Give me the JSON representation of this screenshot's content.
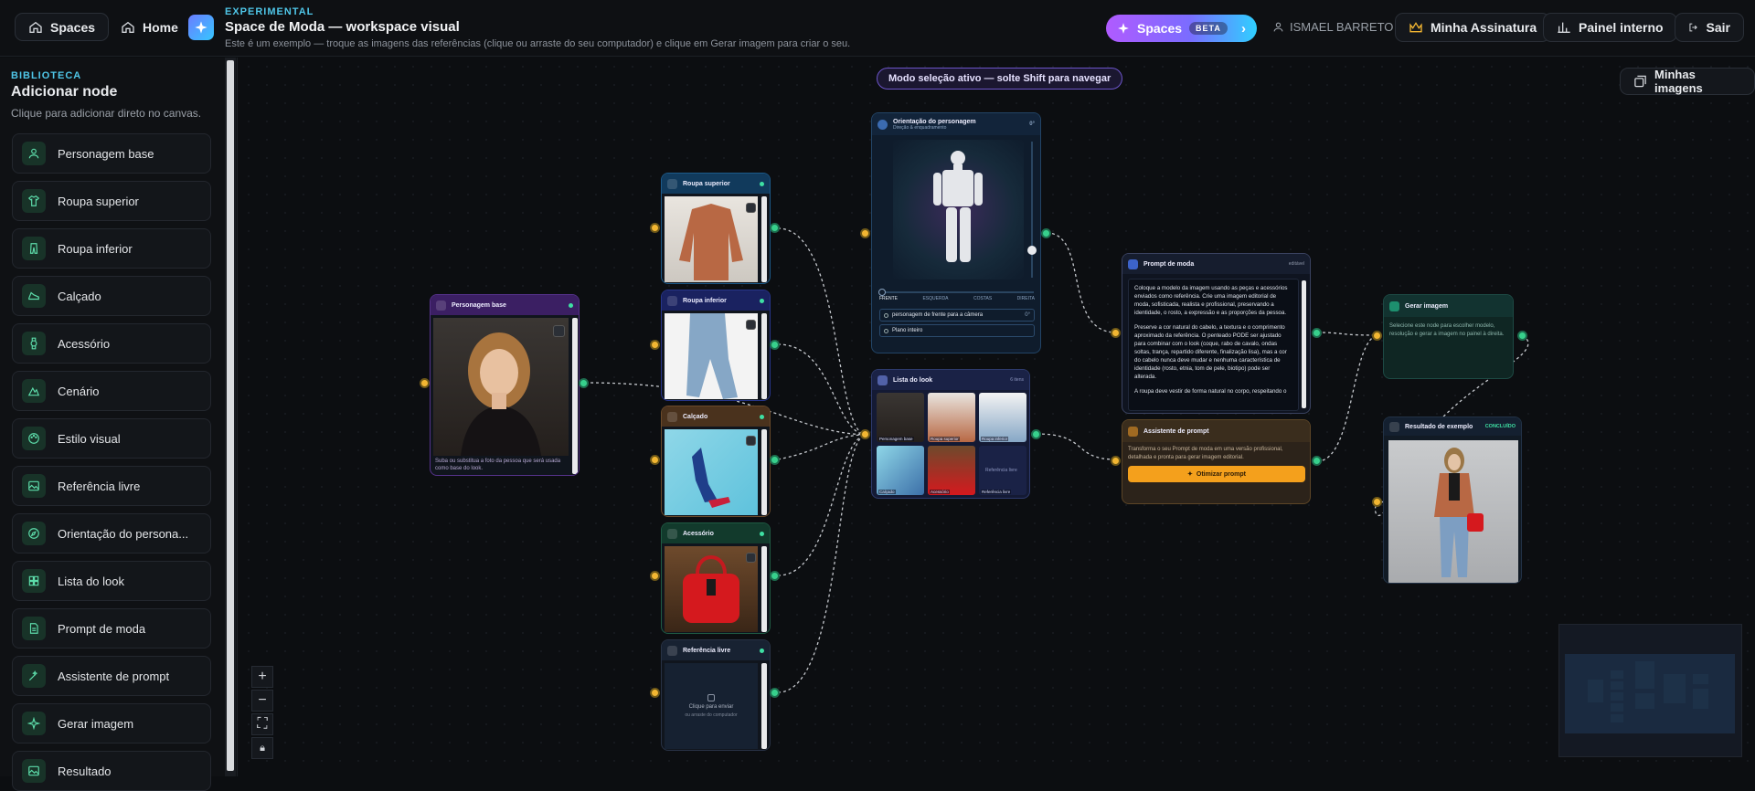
{
  "topbar": {
    "spaces_label": "Spaces",
    "home_label": "Home",
    "kicker": "EXPERIMENTAL",
    "title": "Space de Moda — workspace visual",
    "subtitle": "Este é um exemplo — troque as imagens das referências (clique ou arraste do seu computador) e clique em Gerar imagem para criar o seu.",
    "spaces_btn": "Spaces",
    "beta": "BETA",
    "user": "ISMAEL BARRETO",
    "subscription": "Minha Assinatura",
    "panel": "Painel interno",
    "logout": "Sair"
  },
  "sidebar": {
    "kicker": "BIBLIOTECA",
    "title": "Adicionar node",
    "desc": "Clique para adicionar direto no canvas.",
    "items": [
      {
        "label": "Personagem base",
        "icon": "user-icon"
      },
      {
        "label": "Roupa superior",
        "icon": "shirt-icon"
      },
      {
        "label": "Roupa inferior",
        "icon": "pants-icon"
      },
      {
        "label": "Calçado",
        "icon": "shoe-icon"
      },
      {
        "label": "Acessório",
        "icon": "watch-icon"
      },
      {
        "label": "Cenário",
        "icon": "mountain-icon"
      },
      {
        "label": "Estilo visual",
        "icon": "palette-icon"
      },
      {
        "label": "Referência livre",
        "icon": "image-icon"
      },
      {
        "label": "Orientação do persona...",
        "icon": "compass-icon"
      },
      {
        "label": "Lista do look",
        "icon": "grid-icon"
      },
      {
        "label": "Prompt de moda",
        "icon": "doc-icon"
      },
      {
        "label": "Assistente de prompt",
        "icon": "wand-icon"
      },
      {
        "label": "Gerar imagem",
        "icon": "sparkle-icon"
      },
      {
        "label": "Resultado",
        "icon": "image-icon"
      }
    ]
  },
  "canvas": {
    "mode_banner": "Modo seleção ativo — solte Shift para navegar",
    "my_images": "Minhas imagens",
    "nodes": {
      "personagem": {
        "title": "Personagem base",
        "caption": "Suba ou substitua a foto da pessoa que será usada como base do look."
      },
      "roupa_sup": {
        "title": "Roupa superior"
      },
      "roupa_inf": {
        "title": "Roupa inferior"
      },
      "calcado": {
        "title": "Calçado"
      },
      "acessorio": {
        "title": "Acessório"
      },
      "ref_livre": {
        "title": "Referência livre",
        "hint1": "Clique para enviar",
        "hint2": "ou arraste do computador"
      },
      "orientacao": {
        "title": "Orientação do personagem",
        "subtitle": "Direção & enquadramento",
        "angle": "0°",
        "views": [
          "FRENTE",
          "ESQUERDA",
          "COSTAS",
          "DIREITA"
        ],
        "option1": "personagem de frente para a câmera",
        "option1_val": "0°",
        "option2": "Plano inteiro"
      },
      "lista": {
        "title": "Lista do look",
        "count": "6 itens",
        "cells": [
          "Personagem base",
          "Roupa superior",
          "Roupa inferior",
          "Calçado",
          "Acessório",
          "Referência livre"
        ],
        "extra_label": "Referência livre"
      },
      "prompt": {
        "title": "Prompt de moda",
        "badge": "editável",
        "text1": "Coloque a modelo da imagem usando as peças e acessórios enviados como referência. Crie uma imagem editorial de moda, sofisticada, realista e profissional, preservando a identidade, o rosto, a expressão e as proporções da pessoa.",
        "text2": "Preserve a cor natural do cabelo, a textura e o comprimento aproximado da referência. O penteado PODE ser ajustado para combinar com o look (coque, rabo de cavalo, ondas soltas, trança, repartido diferente, finalização lisa), mas a cor do cabelo nunca deve mudar e nenhuma característica de identidade (rosto, etnia, tom de pele, biotipo) pode ser alterada.",
        "text3": "A roupa deve vestir de forma natural no corpo, respeitando o"
      },
      "assistente": {
        "title": "Assistente de prompt",
        "desc": "Transforma o seu Prompt de moda em uma versão profissional, detalhada e pronta para gerar imagem editorial.",
        "button": "Otimizar prompt"
      },
      "gerar": {
        "title": "Gerar imagem",
        "desc": "Selecione este node para escolher modelo, resolução e gerar a imagem no painel à direita."
      },
      "resultado": {
        "title": "Resultado de exemplo",
        "status": "CONCLUÍDO"
      }
    }
  },
  "colors": {
    "accent_green": "#37d08c",
    "port_yellow": "#f2b632",
    "brand_cyan": "#4fc6e8",
    "optimize_orange": "#f4a01c"
  }
}
